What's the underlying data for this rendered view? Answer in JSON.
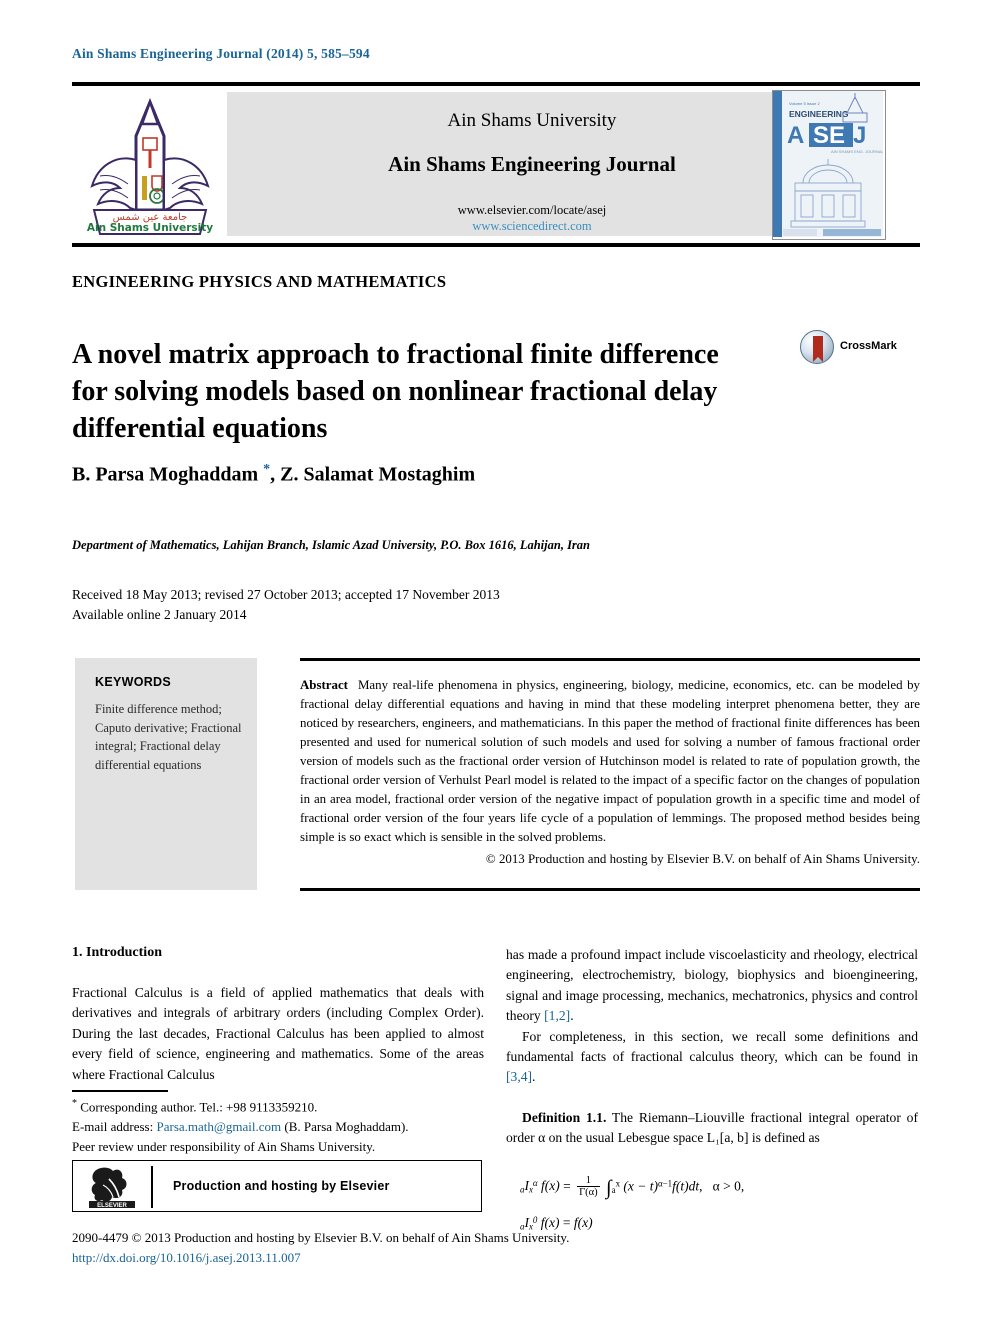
{
  "running_head": "Ain Shams Engineering Journal (2014) 5, 585–594",
  "masthead": {
    "university": "Ain Shams University",
    "journal": "Ain Shams Engineering Journal",
    "url_elsevier": "www.elsevier.com/locate/asej",
    "url_sciencedirect": "www.sciencedirect.com",
    "logo_caption_ar": "جامعة عين شمس",
    "logo_caption_en": "Ain Shams University",
    "cover": {
      "kicker": "Volume 5 Issue 2",
      "line1": "ENGINEERING",
      "acronym": "ASEJ",
      "subtitle": "AIN SHAMS ENGINEERING JOURNAL"
    },
    "colors": {
      "band": "#e2e2e2",
      "link": "#3b8ebf",
      "cover_blue": "#3f79b4",
      "logo_purple": "#3b2a66",
      "logo_red": "#c0392b"
    }
  },
  "article": {
    "subject_area": "ENGINEERING PHYSICS AND MATHEMATICS",
    "title": "A novel matrix approach to fractional finite difference for solving models based on nonlinear fractional delay differential equations",
    "crossmark_label": "CrossMark",
    "authors": "B. Parsa Moghaddam ",
    "authors_tail": ", Z. Salamat Mostaghim",
    "corresponding_marker": "*",
    "affiliation": "Department of Mathematics, Lahijan Branch, Islamic Azad University, P.O. Box 1616, Lahijan, Iran",
    "history_line1": "Received 18 May 2013; revised 27 October 2013; accepted 17 November 2013",
    "history_line2": "Available online 2 January 2014"
  },
  "keywords": {
    "heading": "KEYWORDS",
    "items": "Finite difference method; Caputo derivative; Fractional integral; Fractional delay differential equations"
  },
  "abstract": {
    "label": "Abstract",
    "text": "Many real-life phenomena in physics, engineering, biology, medicine, economics, etc. can be modeled by fractional delay differential equations and having in mind that these modeling interpret phenomena better, they are noticed by researchers, engineers, and mathematicians. In this paper the method of fractional finite differences has been presented and used for numerical solution of such models and used for solving a number of famous fractional order version of models such as the fractional order version of Hutchinson model is related to rate of population growth, the fractional order version of Verhulst Pearl model is related to the impact of a specific factor on the changes of population in an area model, fractional order version of the negative impact of population growth in a specific time and model of fractional order version of the four years life cycle of a population of lemmings. The proposed method besides being simple is so exact which is sensible in the solved problems.",
    "copyright": "© 2013 Production and hosting by Elsevier B.V. on behalf of Ain Shams University."
  },
  "body": {
    "section1_heading": "1. Introduction",
    "left_para1": "Fractional Calculus is a field of applied mathematics that deals with derivatives and integrals of arbitrary orders (including Complex Order). During the last decades, Fractional Calculus has been applied to almost every field of science, engineering and mathematics. Some of the areas where Fractional Calculus",
    "right_para1_a": "has made a profound impact include viscoelasticity and rheology, electrical engineering, electrochemistry, biology, biophysics and bioengineering, signal and image processing, mechanics, mechatronics, physics and control theory ",
    "right_para1_ref": "[1,2]",
    "right_para1_b": ".",
    "right_para2_a": "For completeness, in this section, we recall some definitions and fundamental facts of fractional calculus theory, which can be found in ",
    "right_para2_ref": "[3,4]",
    "right_para2_b": ".",
    "definition_label": "Definition 1.1.",
    "definition_text": " The Riemann–Liouville fractional integral operator of order α on the usual Lebesgue space L₁[a, b] is defined as"
  },
  "formula": {
    "line1": "ₐIˣ_x f(x) = 1/Γ(α) ∫ₐˣ (x − t)^(α−1) f(t)dt,   α > 0,",
    "line2": "ₐI⁰_x f(x) = f(x)",
    "condition": "α > 0,"
  },
  "footnotes": {
    "corresponding": " Corresponding author. Tel.: +98 9113359210.",
    "email_label": "E-mail address: ",
    "email": "Parsa.math@gmail.com",
    "email_tail": " (B. Parsa Moghaddam).",
    "peer_review": "Peer review under responsibility of Ain Shams University.",
    "elsevier_box_text": "Production and hosting by Elsevier",
    "elsevier_wordmark": "ELSEVIER",
    "issn_line": "2090-4479 © 2013 Production and hosting by Elsevier B.V. on behalf of Ain Shams University.",
    "doi": "http://dx.doi.org/10.1016/j.asej.2013.11.007"
  }
}
